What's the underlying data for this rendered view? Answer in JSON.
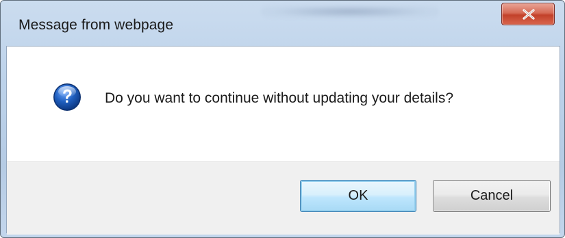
{
  "window": {
    "title": "Message from webpage",
    "close_icon": "close-x-icon"
  },
  "dialog": {
    "icon": "question-icon",
    "message": "Do you want to continue without updating your details?"
  },
  "buttons": {
    "ok_label": "OK",
    "cancel_label": "Cancel"
  },
  "colors": {
    "titlebar": "#bcd2ea",
    "close_button": "#c2412a",
    "ok_border": "#3c7fb1",
    "icon_blue": "#1f5fbf",
    "button_bar": "#f0f0f0"
  }
}
